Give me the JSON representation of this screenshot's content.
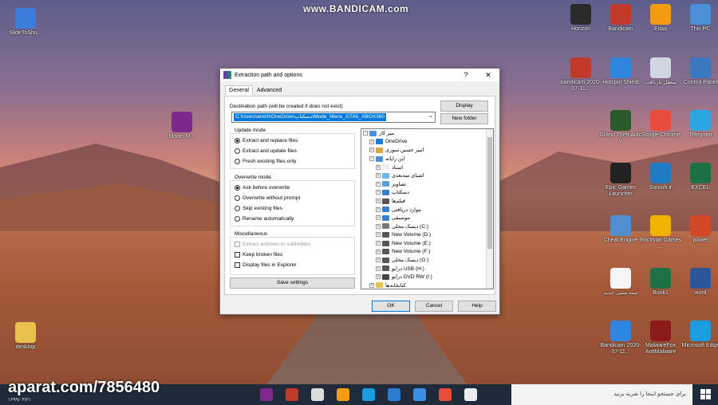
{
  "watermark": {
    "top": "www.BANDICAM.com",
    "bottom": "aparat.com/7856480"
  },
  "desktop_icons": [
    {
      "label": "SlideToShu...",
      "color": "#3b7dd8"
    },
    {
      "label": "Mode_M...",
      "color": "#7b2a8c"
    },
    {
      "label": "desktop",
      "color": "#e8c050"
    },
    {
      "label": "Horizon",
      "color": "#2a2a2a"
    },
    {
      "label": "Bandicam",
      "color": "#c0392b"
    },
    {
      "label": "Eitaa",
      "color": "#f39c12"
    },
    {
      "label": "This PC",
      "color": "#4a90d9"
    },
    {
      "label": "bandicam 2020-07-11...",
      "color": "#c0392b"
    },
    {
      "label": "Hotspot Shield",
      "color": "#2f86e0"
    },
    {
      "label": "سطل بازیافت",
      "color": "#cfd8e0"
    },
    {
      "label": "Control Panel",
      "color": "#3a78c0"
    },
    {
      "label": "Grand Theft Auto V",
      "color": "#2a5a2a"
    },
    {
      "label": "Google Chrome",
      "color": "#e74c3c"
    },
    {
      "label": "Telegram",
      "color": "#2ca5e0"
    },
    {
      "label": "Epic Games Launcher",
      "color": "#222222"
    },
    {
      "label": "Sorouh.ir",
      "color": "#1f7bc4"
    },
    {
      "label": "EXCEL",
      "color": "#1e7145"
    },
    {
      "label": "Cheat Engine",
      "color": "#4f8fd0"
    },
    {
      "label": "Rockstar Games ...",
      "color": "#f0b400"
    },
    {
      "label": "power",
      "color": "#d24726"
    },
    {
      "label": "سند متنی جدید",
      "color": "#f5f5f5"
    },
    {
      "label": "Book1",
      "color": "#1e7145"
    },
    {
      "label": "word",
      "color": "#2b579a"
    },
    {
      "label": "Bandicam 2020-07-11...",
      "color": "#2f86e0"
    },
    {
      "label": "MalwareFox AntiMalware",
      "color": "#8b1a1a"
    },
    {
      "label": "Microsoft Edge",
      "color": "#1b9de2"
    }
  ],
  "dialog": {
    "title": "Extraction path and options",
    "help_glyph": "?",
    "close_glyph": "✕",
    "tabs": [
      "General",
      "Advanced"
    ],
    "destination_label": "Destination path (will be created if does not exist)",
    "path_value": "C:\\Users\\amirh\\OneDrive\\دسکتاپ\\Mode_Menu_GTA5_XBOX360",
    "display_button": "Display",
    "new_folder_button": "New folder",
    "update_mode": {
      "title": "Update mode",
      "options": [
        "Extract and replace files",
        "Extract and update files",
        "Fresh existing files only"
      ],
      "selected": 0
    },
    "overwrite_mode": {
      "title": "Overwrite mode",
      "options": [
        "Ask before overwrite",
        "Overwrite without prompt",
        "Skip existing files",
        "Rename automatically"
      ],
      "selected": 0
    },
    "misc": {
      "title": "Miscellaneous",
      "options": [
        {
          "label": "Extract archives to subfolders",
          "checked": false,
          "disabled": true
        },
        {
          "label": "Keep broken files",
          "checked": false,
          "disabled": false
        },
        {
          "label": "Display files in Explorer",
          "checked": false,
          "disabled": false
        }
      ]
    },
    "save_settings": "Save settings",
    "tree": [
      {
        "label": "میز کار",
        "level": 0,
        "color": "#4a90d9"
      },
      {
        "label": "OneDrive",
        "level": 1,
        "color": "#1e78d4"
      },
      {
        "label": "امیر حسین سوری",
        "level": 1,
        "color": "#d9a64a"
      },
      {
        "label": "این رایانه",
        "level": 1,
        "color": "#4a90d9"
      },
      {
        "label": "اسناد",
        "level": 2,
        "color": "#eeeeee"
      },
      {
        "label": "اشیای سه‌بعدی",
        "level": 2,
        "color": "#6fb3e0"
      },
      {
        "label": "تصاویر",
        "level": 2,
        "color": "#5aa0d0"
      },
      {
        "label": "دسکتاپ",
        "level": 2,
        "color": "#3a7ec8"
      },
      {
        "label": "فیلم‌ها",
        "level": 2,
        "color": "#555555"
      },
      {
        "label": "موارد دریافتی",
        "level": 2,
        "color": "#3a7ec8"
      },
      {
        "label": "موسیقی",
        "level": 2,
        "color": "#3a7ec8"
      },
      {
        "label": "دیسک محلی (C:)",
        "level": 2,
        "color": "#777777"
      },
      {
        "label": "New Volume (D:)",
        "level": 2,
        "color": "#555555"
      },
      {
        "label": "New Volume (E:)",
        "level": 2,
        "color": "#555555"
      },
      {
        "label": "New Volume (F:)",
        "level": 2,
        "color": "#555555"
      },
      {
        "label": "دیسک محلی (G:)",
        "level": 2,
        "color": "#555555"
      },
      {
        "label": "درایو USB (H:)",
        "level": 2,
        "color": "#555555"
      },
      {
        "label": "درایو DVD RW (I:)",
        "level": 2,
        "color": "#444444"
      },
      {
        "label": "کتابخانه‌ها",
        "level": 1,
        "color": "#e8c050"
      }
    ],
    "ok": "OK",
    "cancel": "Cancel",
    "help": "Help"
  },
  "taskbar": {
    "search_placeholder": "برای جستجو اینجا را ضربه بزنید",
    "clock": "۱۳۹۹/۰۴/۲۱",
    "apps": [
      {
        "name": "winrar-icon",
        "color": "#7b2a8c"
      },
      {
        "name": "bandicam-icon",
        "color": "#c0392b"
      },
      {
        "name": "cloud-icon",
        "color": "#dddddd"
      },
      {
        "name": "eitaa-icon",
        "color": "#f39c12"
      },
      {
        "name": "edge-icon",
        "color": "#1b9de2"
      },
      {
        "name": "mail-icon",
        "color": "#2b7cd3"
      },
      {
        "name": "store-icon",
        "color": "#3a8ee6"
      },
      {
        "name": "chrome-icon",
        "color": "#e74c3c"
      },
      {
        "name": "task-view-icon",
        "color": "#eeeeee"
      }
    ]
  }
}
